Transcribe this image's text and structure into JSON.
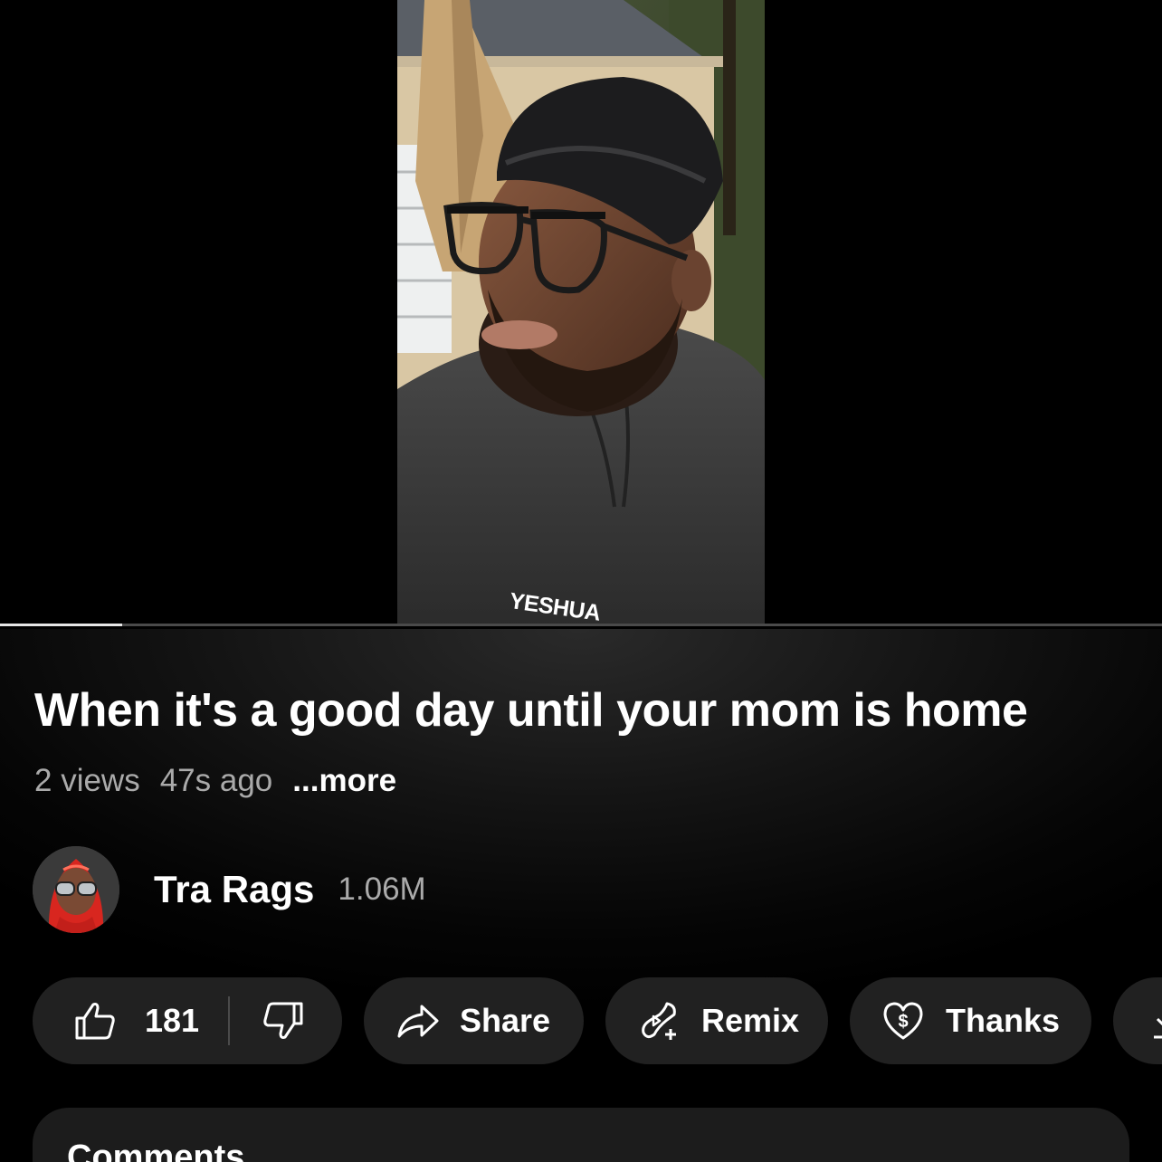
{
  "video": {
    "shirt_text": "YESHUA",
    "progress_fraction": 0.105
  },
  "details": {
    "title": "When it's a good day until your mom is home",
    "views": "2 views",
    "age": "47s ago",
    "more": "...more"
  },
  "channel": {
    "name": "Tra Rags",
    "subscribers": "1.06M"
  },
  "actions": {
    "like_count": "181",
    "share_label": "Share",
    "remix_label": "Remix",
    "thanks_label": "Thanks",
    "icons": [
      "thumbs-up-icon",
      "thumbs-down-icon",
      "share-arrow-icon",
      "remix-icon",
      "thanks-heart-dollar-icon",
      "download-icon"
    ]
  },
  "comments": {
    "title": "Comments"
  },
  "colors": {
    "background": "#000000",
    "pill": "#212121",
    "muted_text": "#aaaaaa",
    "progress_fill": "#e6e6e6",
    "progress_track": "#4a4a4a"
  }
}
